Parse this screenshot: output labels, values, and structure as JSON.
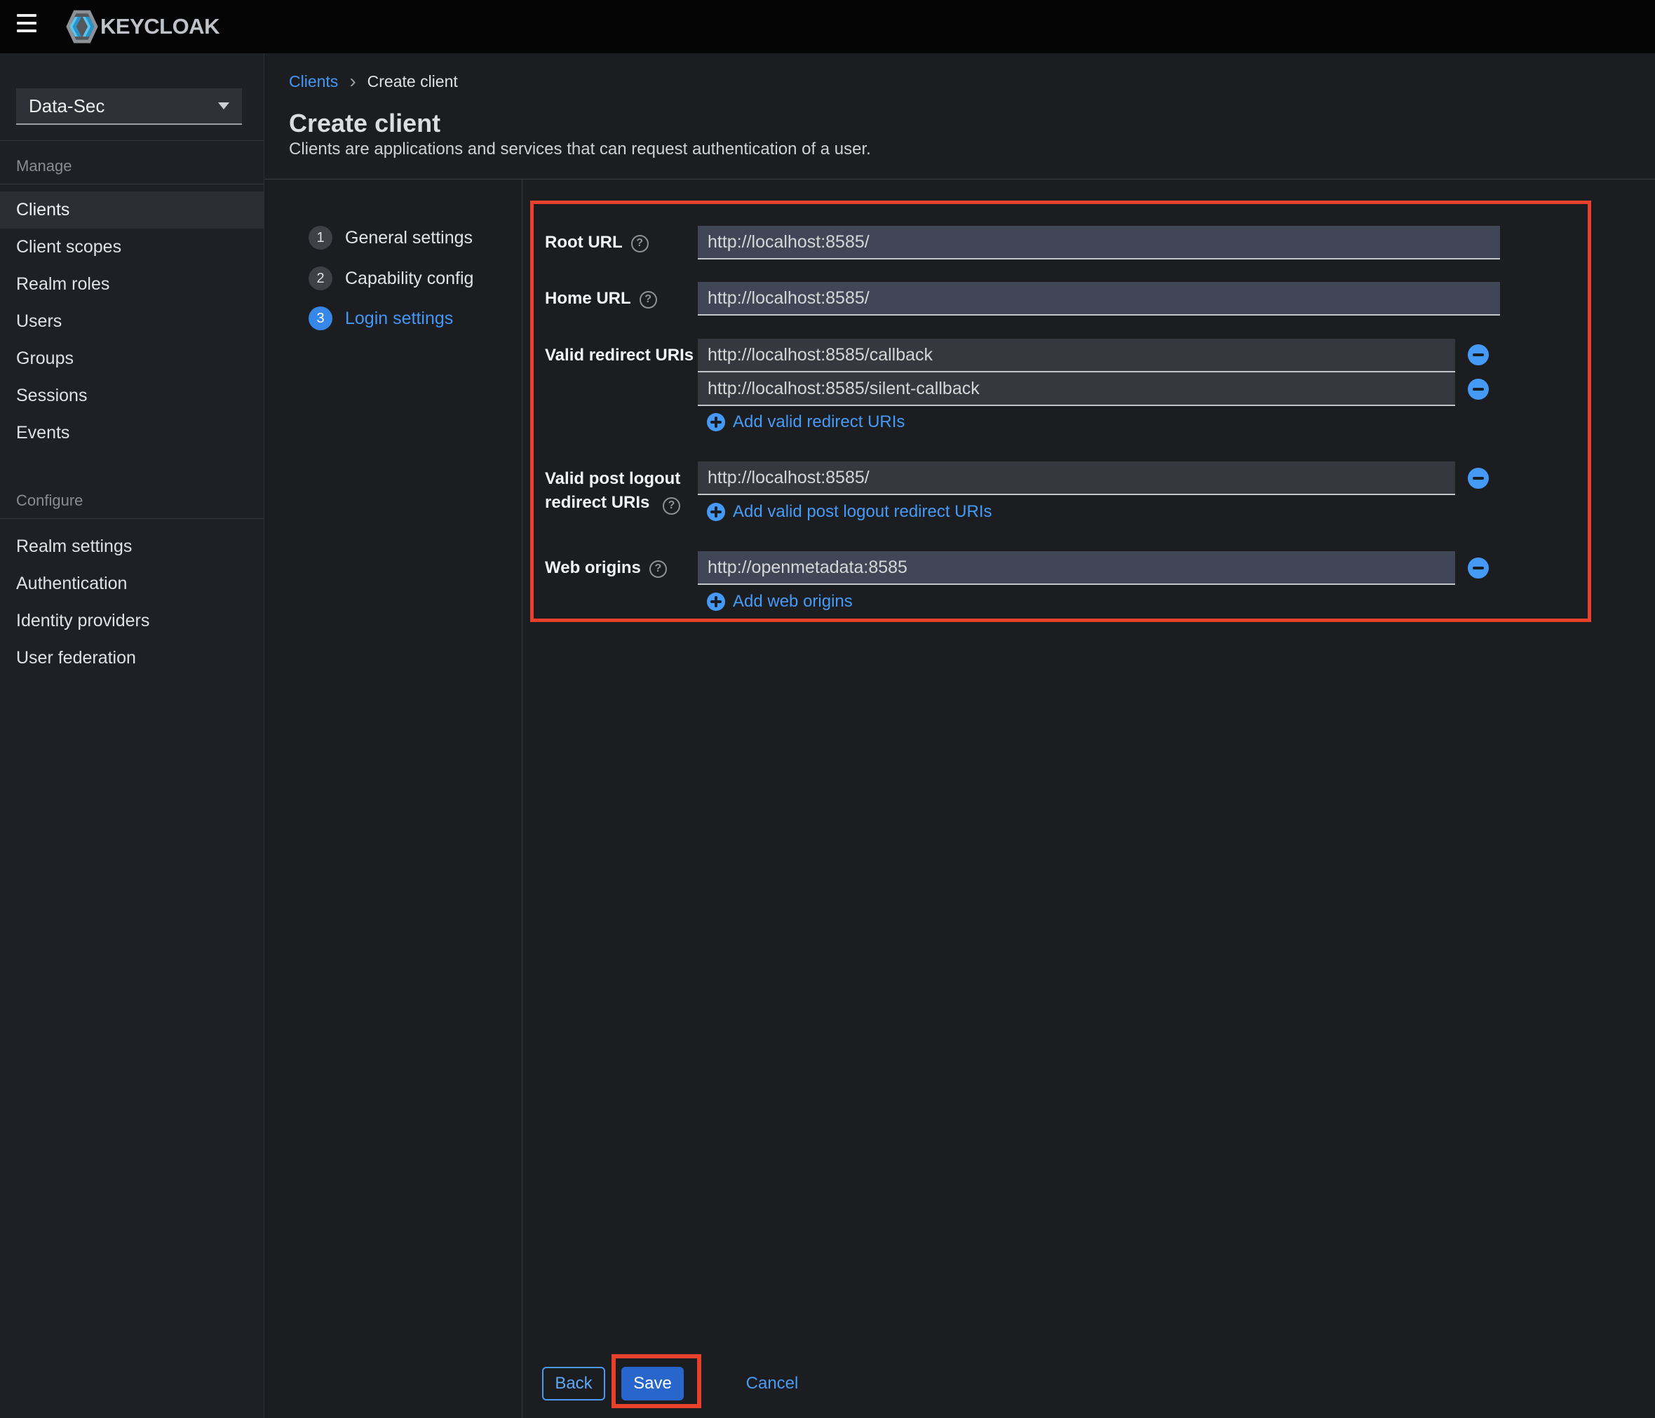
{
  "masthead": {
    "brand": "KEYCLOAK"
  },
  "sidebar": {
    "realm": "Data-Sec",
    "selected_item": "Clients",
    "sections": [
      {
        "label": "Manage",
        "items": [
          "Clients",
          "Client scopes",
          "Realm roles",
          "Users",
          "Groups",
          "Sessions",
          "Events"
        ]
      },
      {
        "label": "Configure",
        "items": [
          "Realm settings",
          "Authentication",
          "Identity providers",
          "User federation"
        ]
      }
    ]
  },
  "breadcrumb": {
    "parent": "Clients",
    "separator": "›",
    "current": "Create client"
  },
  "page_header": {
    "title": "Create client",
    "subtitle": "Clients are applications and services that can request authentication of a user."
  },
  "wizard": {
    "active_step": "Login settings",
    "steps": [
      {
        "number": "1",
        "label": "General settings"
      },
      {
        "number": "2",
        "label": "Capability config"
      },
      {
        "number": "3",
        "label": "Login settings"
      }
    ]
  },
  "form": {
    "root_url": {
      "label": "Root URL",
      "value": "http://localhost:8585/"
    },
    "home_url": {
      "label": "Home URL",
      "value": "http://localhost:8585/"
    },
    "redirect_uris": {
      "label": "Valid redirect URIs",
      "values": [
        "http://localhost:8585/callback",
        "http://localhost:8585/silent-callback"
      ],
      "add_label": "Add valid redirect URIs"
    },
    "post_logout_uris": {
      "label_line1": "Valid post logout",
      "label_line2": "redirect URIs",
      "values": [
        "http://localhost:8585/"
      ],
      "add_label": "Add valid post logout redirect URIs"
    },
    "web_origins": {
      "label": "Web origins",
      "values": [
        "http://openmetadata:8585"
      ],
      "add_label": "Add web origins"
    }
  },
  "footer": {
    "back_label": "Back",
    "save_label": "Save",
    "cancel_label": "Cancel"
  },
  "icons": {
    "menu": "hamburger-icon",
    "realm_caret": "caret-down-icon",
    "help": "question-circle-icon",
    "remove": "minus-circle-icon",
    "add": "plus-circle-icon"
  },
  "colors": {
    "annotation_red": "#e7402b",
    "primary_blue": "#2966cc",
    "link_blue": "#459af6",
    "active_step_blue": "#3687e8",
    "input_bg_light": "#414656",
    "input_bg_dark": "#35383e",
    "masthead_bg": "#050505",
    "sidebar_bg": "#1d2024",
    "content_bg": "#1b1d21"
  }
}
